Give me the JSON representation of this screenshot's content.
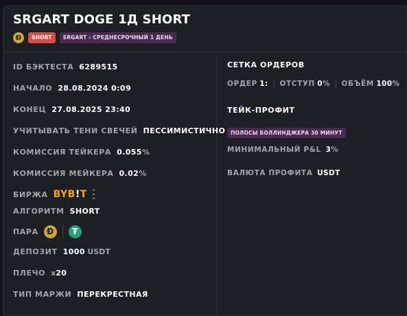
{
  "header": {
    "title": "SRGART DOGE 1Д SHORT",
    "coin_glyph": "Ð",
    "direction_tag": "SHORT",
    "strategy_tag": "SRGART - СРЕДНЕСРОЧНЫЙ 1 ДЕНЬ"
  },
  "left": {
    "backtest_id": {
      "label": "ID БЭКТЕСТА",
      "value": "6289515"
    },
    "start": {
      "label": "НАЧАЛО",
      "value": "28.08.2024 0:09"
    },
    "end": {
      "label": "КОНЕЦ",
      "value": "27.08.2025 23:40"
    },
    "shadows": {
      "label": "УЧИТЫВАТЬ ТЕНИ СВЕЧЕЙ",
      "value": "ПЕССИМИСТИЧНО"
    },
    "taker_fee": {
      "label": "КОМИССИЯ ТЕЙКЕРА",
      "value": "0.055",
      "unit": "%"
    },
    "maker_fee": {
      "label": "КОМИССИЯ МЕЙКЕРА",
      "value": "0.02",
      "unit": "%"
    },
    "exchange": {
      "label": "БИРЖА",
      "logo_main": "BYB",
      "logo_mark": "!",
      "logo_tail": "T"
    },
    "algorithm": {
      "label": "АЛГОРИТМ",
      "value": "SHORT"
    },
    "pair": {
      "label": "ПАРА",
      "base_glyph": "Ð",
      "quote_glyph": "₮"
    },
    "deposit": {
      "label": "ДЕПОЗИТ",
      "value": "1000",
      "unit": "USDT"
    },
    "leverage": {
      "label": "ПЛЕЧО",
      "prefix": "x",
      "value": "20"
    },
    "margin": {
      "label": "ТИП МАРЖИ",
      "value": "ПЕРЕКРЕСТНАЯ"
    }
  },
  "right": {
    "grid": {
      "title": "СЕТКА ОРДЕРОВ",
      "order_label": "ОРДЕР",
      "order_value": "1:",
      "offset_label": "ОТСТУП",
      "offset_value": "0",
      "offset_unit": "%",
      "volume_label": "ОБЪЁМ",
      "volume_value": "100",
      "volume_unit": "%"
    },
    "take_profit": {
      "title": "ТЕЙК-ПРОФИТ",
      "indicator_tag": "ПОЛОСЫ БОЛЛИНДЖЕРА 30 МИНУТ",
      "min_pnl": {
        "label": "МИНИМАЛЬНЫЙ P&L",
        "value": "3",
        "unit": "%"
      },
      "currency": {
        "label": "ВАЛЮТА ПРОФИТА",
        "value": "USDT"
      }
    }
  },
  "colors": {
    "doge": "#c9a73a",
    "tether": "#26a17b",
    "short": "#d94d48",
    "bybit": "#f7a600",
    "tag": "#4a2a52"
  }
}
